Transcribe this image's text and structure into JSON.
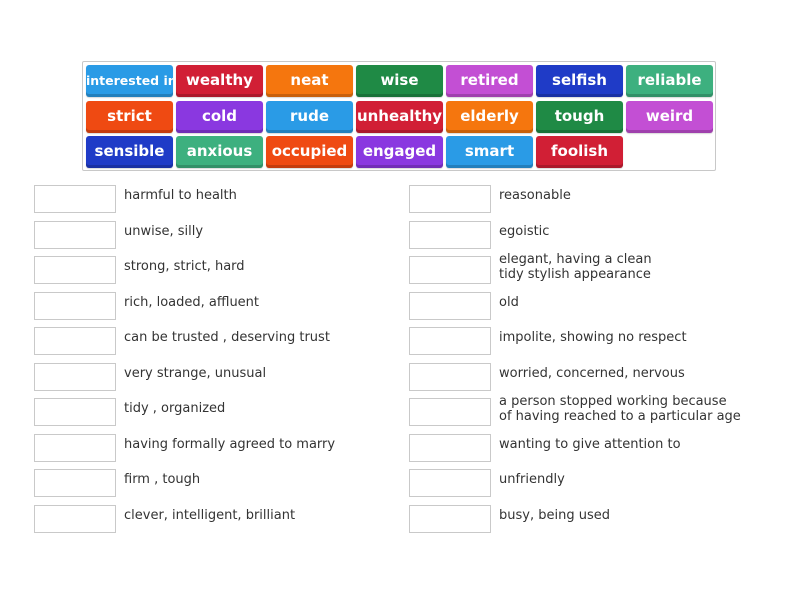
{
  "tiles": [
    {
      "label": "interested in",
      "color": "#2a9be6"
    },
    {
      "label": "wealthy",
      "color": "#d11f35"
    },
    {
      "label": "neat",
      "color": "#f5760e"
    },
    {
      "label": "wise",
      "color": "#1f8a45"
    },
    {
      "label": "retired",
      "color": "#c34fd4"
    },
    {
      "label": "selfish",
      "color": "#1f3bc7"
    },
    {
      "label": "reliable",
      "color": "#3db07f"
    },
    {
      "label": "strict",
      "color": "#ef4a12"
    },
    {
      "label": "cold",
      "color": "#8a38e0"
    },
    {
      "label": "rude",
      "color": "#2a9be6"
    },
    {
      "label": "unhealthy",
      "color": "#d11f35"
    },
    {
      "label": "elderly",
      "color": "#f5760e"
    },
    {
      "label": "tough",
      "color": "#1f8a45"
    },
    {
      "label": "weird",
      "color": "#c34fd4"
    },
    {
      "label": "sensible",
      "color": "#1f3bc7"
    },
    {
      "label": "anxious",
      "color": "#3db07f"
    },
    {
      "label": "occupied",
      "color": "#ef4a12"
    },
    {
      "label": "engaged",
      "color": "#8a38e0"
    },
    {
      "label": "smart",
      "color": "#2a9be6"
    },
    {
      "label": "foolish",
      "color": "#d11f35"
    }
  ],
  "left_definitions": [
    "harmful to health",
    "unwise, silly",
    "strong, strict, hard",
    "rich, loaded, affluent",
    "can be trusted , deserving trust",
    "very strange, unusual",
    "tidy , organized",
    "having formally agreed to marry",
    "firm , tough",
    "clever, intelligent, brilliant"
  ],
  "right_definitions": [
    "reasonable",
    "egoistic",
    "elegant, having a clean\ntidy stylish appearance",
    "old",
    "impolite, showing no respect",
    "worried, concerned, nervous",
    "a person stopped working because\nof having reached to a particular age",
    "wanting to give attention to",
    "unfriendly",
    "busy, being used"
  ]
}
